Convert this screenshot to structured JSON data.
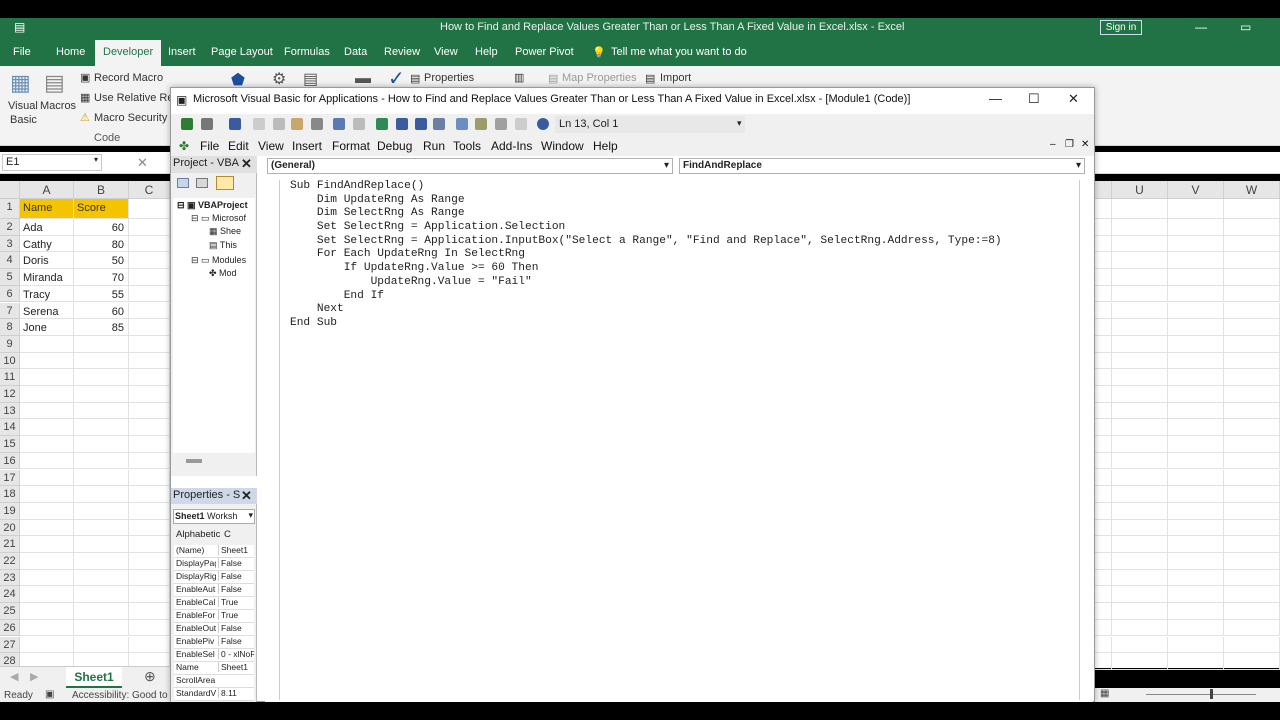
{
  "excel": {
    "window_title": "How to Find and Replace Values Greater Than or Less Than A Fixed Value in Excel.xlsx  -  Excel",
    "sign_in": "Sign in",
    "tabs": [
      "File",
      "Home",
      "Developer",
      "Insert",
      "Page Layout",
      "Formulas",
      "Data",
      "Review",
      "View",
      "Help",
      "Power Pivot"
    ],
    "tell_me": "Tell me what you want to do",
    "ribbon": {
      "record_macro": "Record Macro",
      "use_relative": "Use Relative Refe",
      "macro_security": "Macro Security",
      "visual_basic": "Visual",
      "visual_basic_2": "Basic",
      "macros": "Macros",
      "code_group": "Code",
      "properties": "Properties",
      "map_properties": "Map Properties",
      "import": "Import"
    },
    "name_box": "E1",
    "columns": [
      "A",
      "B",
      "C"
    ],
    "right_columns": [
      "U",
      "V",
      "W"
    ],
    "rows": [
      {
        "n": "1",
        "a": "Name",
        "b": "Score",
        "header": true
      },
      {
        "n": "2",
        "a": "Ada",
        "b": "60"
      },
      {
        "n": "3",
        "a": "Cathy",
        "b": "80"
      },
      {
        "n": "4",
        "a": "Doris",
        "b": "50"
      },
      {
        "n": "5",
        "a": "Miranda",
        "b": "70"
      },
      {
        "n": "6",
        "a": "Tracy",
        "b": "55"
      },
      {
        "n": "7",
        "a": "Serena",
        "b": "60"
      },
      {
        "n": "8",
        "a": "Jone",
        "b": "85"
      },
      {
        "n": "9"
      },
      {
        "n": "10"
      },
      {
        "n": "11"
      },
      {
        "n": "12"
      },
      {
        "n": "13"
      },
      {
        "n": "14"
      },
      {
        "n": "15"
      },
      {
        "n": "16"
      },
      {
        "n": "17"
      },
      {
        "n": "18"
      },
      {
        "n": "19"
      },
      {
        "n": "20"
      },
      {
        "n": "21"
      },
      {
        "n": "22"
      },
      {
        "n": "23"
      },
      {
        "n": "24"
      },
      {
        "n": "25"
      },
      {
        "n": "26"
      },
      {
        "n": "27"
      },
      {
        "n": "28"
      }
    ],
    "sheet_tab": "Sheet1",
    "status_ready": "Ready",
    "status_accessibility": "Accessibility: Good to"
  },
  "vba": {
    "title": "Microsoft Visual Basic for Applications - How to Find and Replace Values Greater Than or Less Than A Fixed Value in Excel.xlsx - [Module1 (Code)]",
    "ln_col": "Ln 13, Col 1",
    "menu": [
      "File",
      "Edit",
      "View",
      "Insert",
      "Format",
      "Debug",
      "Run",
      "Tools",
      "Add-Ins",
      "Window",
      "Help"
    ],
    "project_title": "Project - VBA",
    "tree": [
      "VBAProject",
      "Microsof",
      "Shee",
      "This",
      "Modules",
      "Mod"
    ],
    "properties_title": "Properties - S",
    "properties_object": "Sheet1",
    "properties_type": "Worksh",
    "properties_tabs": [
      "Alphabetic",
      "C"
    ],
    "properties": [
      {
        "name": "(Name)",
        "value": "Sheet1"
      },
      {
        "name": "DisplayPag",
        "value": "False"
      },
      {
        "name": "DisplayRig",
        "value": "False"
      },
      {
        "name": "EnableAut",
        "value": "False"
      },
      {
        "name": "EnableCal",
        "value": "True"
      },
      {
        "name": "EnableFor",
        "value": "True"
      },
      {
        "name": "EnableOut",
        "value": "False"
      },
      {
        "name": "EnablePiv",
        "value": "False"
      },
      {
        "name": "EnableSel",
        "value": "0 - xlNoR"
      },
      {
        "name": "Name",
        "value": "Sheet1"
      },
      {
        "name": "ScrollArea",
        "value": ""
      },
      {
        "name": "StandardV",
        "value": "8.11"
      }
    ],
    "combo_general": "(General)",
    "combo_proc": "FindAndReplace",
    "code_lines": [
      "Sub FindAndReplace()",
      "    Dim UpdateRng As Range",
      "    Dim SelectRng As Range",
      "    Set SelectRng = Application.Selection",
      "    Set SelectRng = Application.InputBox(\"Select a Range\", \"Find and Replace\", SelectRng.Address, Type:=8)",
      "    For Each UpdateRng In SelectRng",
      "        If UpdateRng.Value >= 60 Then",
      "            UpdateRng.Value = \"Fail\"",
      "        End If",
      "    Next",
      "End Sub"
    ]
  }
}
